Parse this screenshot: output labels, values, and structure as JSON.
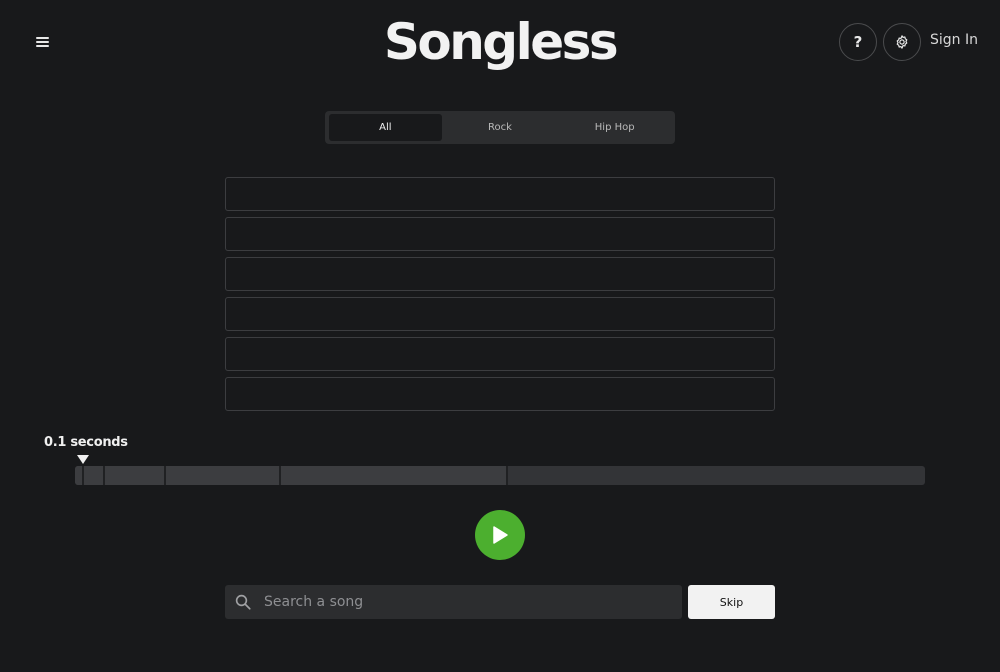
{
  "header": {
    "logo": "Songless",
    "help_label": "?",
    "signin_label": "Sign In",
    "icons": {
      "menu": "hamburger-menu-icon",
      "settings": "gear-icon",
      "help": "question-icon"
    }
  },
  "genre_tabs": [
    {
      "label": "All",
      "active": true
    },
    {
      "label": "Rock",
      "active": false
    },
    {
      "label": "Hip Hop",
      "active": false
    }
  ],
  "guess_slots": [
    "",
    "",
    "",
    "",
    "",
    ""
  ],
  "timeline": {
    "current_label": "0.1 seconds"
  },
  "search": {
    "placeholder": "Search a song",
    "value": ""
  },
  "skip_label": "Skip",
  "colors": {
    "background": "#18191b",
    "accent_green": "#4caf2f",
    "panel": "#2c2d2f"
  }
}
